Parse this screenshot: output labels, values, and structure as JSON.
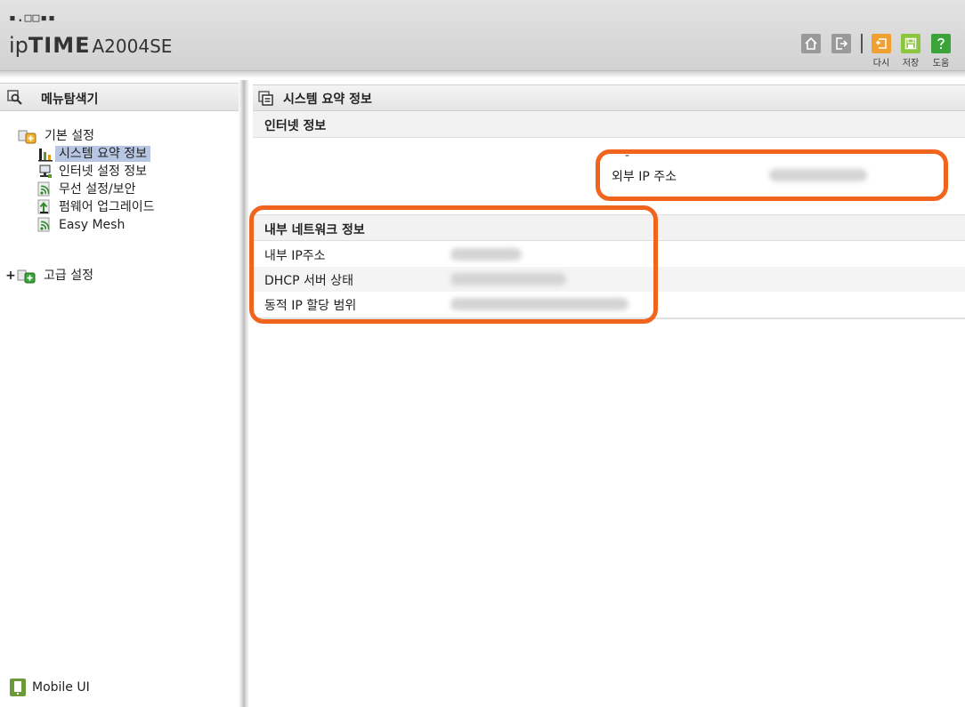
{
  "header": {
    "logo_dots": "▪.□□▪▪",
    "brand_ip": "ip",
    "brand_time": "TIME",
    "brand_model": "A2004SE",
    "toolbar": {
      "home_icon": "home-icon",
      "logout_icon": "logout-icon",
      "redo_label": "다시",
      "save_label": "저장",
      "help_label": "도움",
      "redo_color": "#f0a030",
      "save_color": "#8cc63f",
      "help_color": "#3aa43a"
    }
  },
  "sidebar": {
    "title": "메뉴탐색기",
    "basic_group": "기본 설정",
    "items": [
      {
        "label": "시스템 요약 정보",
        "icon": "chart-icon"
      },
      {
        "label": "인터넷 설정 정보",
        "icon": "network-icon"
      },
      {
        "label": "무선 설정/보안",
        "icon": "wireless-icon"
      },
      {
        "label": "펌웨어 업그레이드",
        "icon": "upgrade-icon"
      },
      {
        "label": "Easy Mesh",
        "icon": "wireless-icon"
      }
    ],
    "advanced_expand": "+",
    "advanced_group": "고급 설정",
    "mobile_ui": "Mobile UI"
  },
  "main": {
    "title": "시스템 요약 정보",
    "internet_section": "인터넷 정보",
    "internet_dash": "-",
    "external_ip_label": "외부 IP 주소",
    "internal_section": "내부 네트워크 정보",
    "internal_ip_label": "내부 IP주소",
    "dhcp_label": "DHCP 서버 상태",
    "dynamic_range_label": "동적 IP 할당 범위",
    "highlight_color": "#f0641e",
    "selected_color": "#b7c6e2"
  }
}
